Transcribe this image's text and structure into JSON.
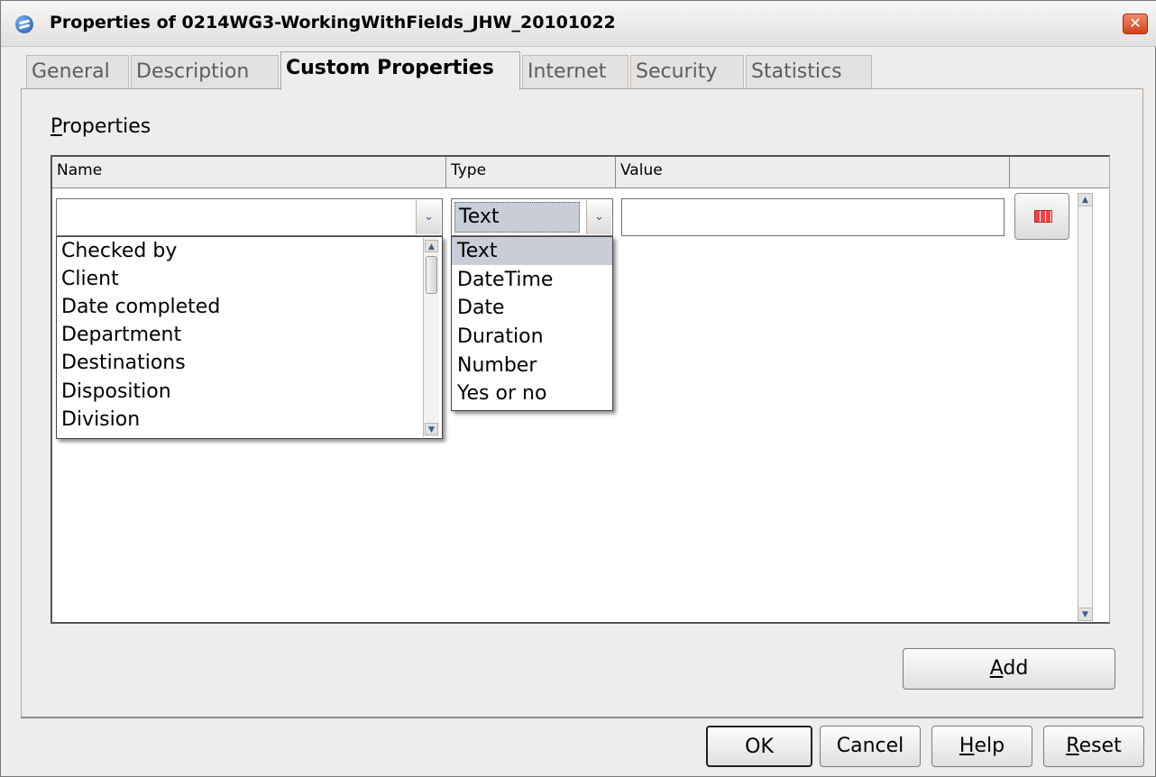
{
  "window": {
    "title": "Properties of 0214WG3-WorkingWithFields_JHW_20101022",
    "close_glyph": "✕"
  },
  "tabs": [
    {
      "label": "General",
      "active": false
    },
    {
      "label": "Description",
      "active": false
    },
    {
      "label": "Custom Properties",
      "active": true
    },
    {
      "label": "Internet",
      "active": false
    },
    {
      "label": "Security",
      "active": false
    },
    {
      "label": "Statistics",
      "active": false
    }
  ],
  "properties": {
    "label_mnemonic": "P",
    "label_rest": "roperties",
    "columns": [
      "Name",
      "Type",
      "Value",
      ""
    ],
    "row": {
      "name_value": "",
      "type_value": "Text",
      "value_value": ""
    }
  },
  "name_dropdown": {
    "options": [
      "Checked by",
      "Client",
      "Date completed",
      "Department",
      "Destinations",
      "Disposition",
      "Division"
    ]
  },
  "type_dropdown": {
    "options": [
      "Text",
      "DateTime",
      "Date",
      "Duration",
      "Number",
      "Yes or no"
    ],
    "highlighted": "Text"
  },
  "icons": {
    "dropdown_arrow": "⌄",
    "scroll_up": "▲",
    "scroll_down": "▼"
  },
  "buttons": {
    "add": {
      "mnemonic": "A",
      "rest": "dd"
    },
    "ok": "OK",
    "cancel": "Cancel",
    "help": {
      "mnemonic": "H",
      "rest": "elp"
    },
    "reset": {
      "mnemonic": "R",
      "rest": "eset"
    }
  }
}
